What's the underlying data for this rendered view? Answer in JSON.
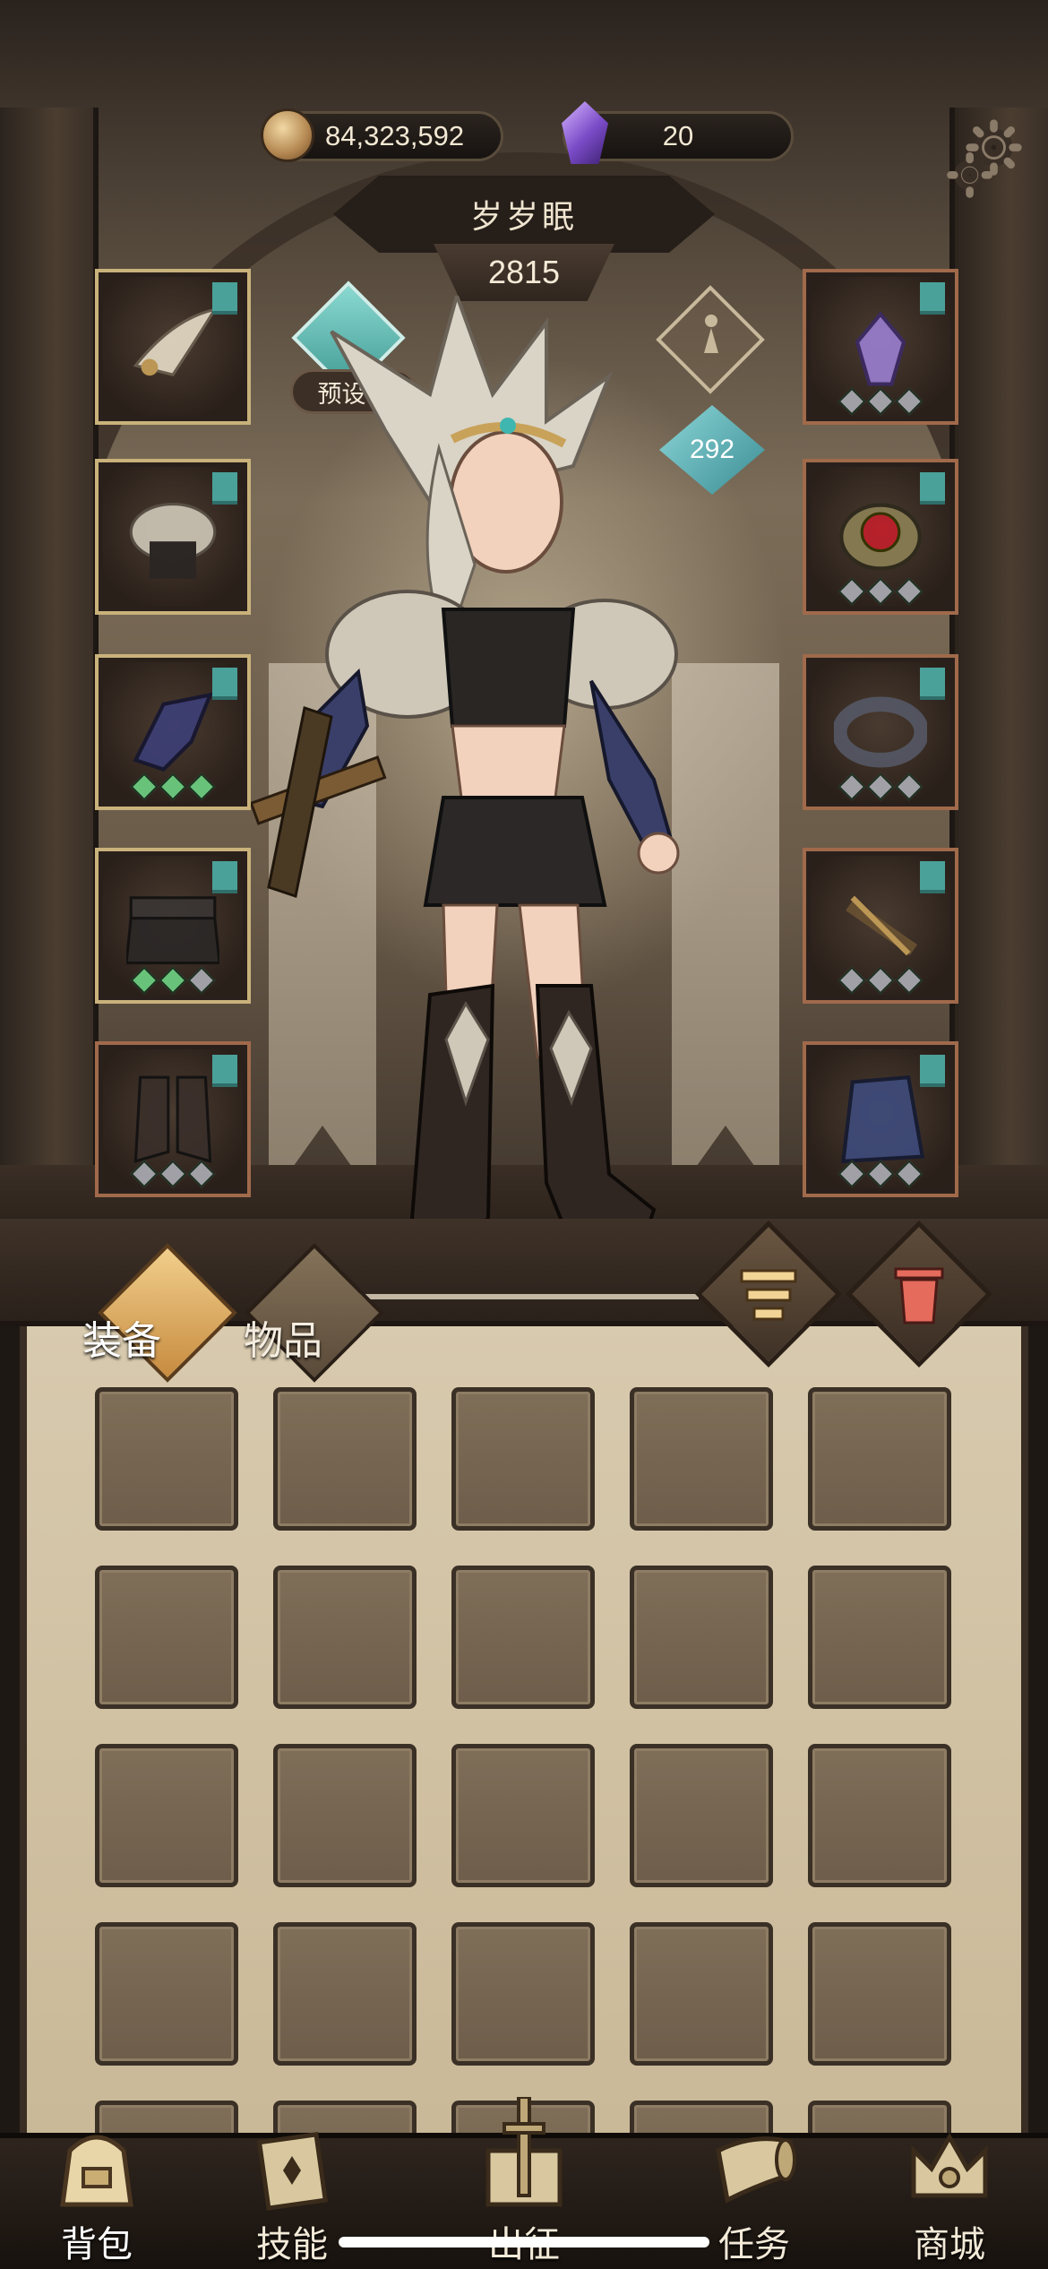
{
  "currencies": {
    "gold": {
      "icon": "coin-icon",
      "value": "84,323,592"
    },
    "gems": {
      "icon": "purple-gem-icon",
      "value": "20"
    }
  },
  "character": {
    "name": "岁岁眠",
    "power": "2815",
    "level": "292",
    "preset_label": "预设一"
  },
  "equipment": {
    "left": [
      {
        "slot": "headgear",
        "frame": "gold",
        "gems": []
      },
      {
        "slot": "armor",
        "frame": "gold",
        "gems": []
      },
      {
        "slot": "gauntlets",
        "frame": "gold",
        "gems": [
          "green",
          "green",
          "green"
        ]
      },
      {
        "slot": "belt",
        "frame": "gold",
        "gems": [
          "green",
          "green",
          "grey"
        ]
      },
      {
        "slot": "boots",
        "frame": "bronze",
        "gems": [
          "grey",
          "grey",
          "grey"
        ]
      }
    ],
    "right": [
      {
        "slot": "amulet",
        "frame": "bronze",
        "gems": [
          "grey",
          "grey",
          "grey"
        ]
      },
      {
        "slot": "eye-charm",
        "frame": "bronze",
        "gems": [
          "grey",
          "grey",
          "grey"
        ]
      },
      {
        "slot": "ring",
        "frame": "bronze",
        "gems": [
          "grey",
          "grey",
          "grey"
        ]
      },
      {
        "slot": "crossbow",
        "frame": "bronze",
        "gems": [
          "grey",
          "grey",
          "grey"
        ]
      },
      {
        "slot": "cloak",
        "frame": "bronze",
        "gems": [
          "grey",
          "grey",
          "grey"
        ]
      }
    ]
  },
  "inventory": {
    "tabs": [
      {
        "label": "装备",
        "active": true
      },
      {
        "label": "物品",
        "active": false
      }
    ],
    "sort_icon": "sort-list-icon",
    "trash_icon": "trash-icon",
    "slot_count": 25
  },
  "bottom_nav": [
    {
      "label": "背包",
      "icon": "backpack-icon",
      "active": true
    },
    {
      "label": "技能",
      "icon": "skill-book-icon",
      "active": false
    },
    {
      "label": "出征",
      "icon": "sword-icon",
      "active": false
    },
    {
      "label": "任务",
      "icon": "horn-icon",
      "active": false
    },
    {
      "label": "商城",
      "icon": "shop-crown-icon",
      "active": false
    }
  ],
  "colors": {
    "accent_teal": "#4aa19a",
    "gold_frame": "#c9b27b",
    "bronze_frame": "#a06a4b",
    "panel_parchment": "#d9cbb0"
  }
}
